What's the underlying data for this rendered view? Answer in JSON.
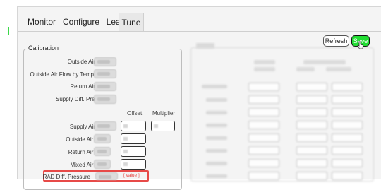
{
  "tabs": [
    {
      "label": "Monitor",
      "active": false
    },
    {
      "label": "Configure",
      "active": false
    },
    {
      "label": "Learn",
      "active": false
    },
    {
      "label": "Tune",
      "active": true
    }
  ],
  "toolbar": {
    "refresh_label": "Refresh",
    "save_label": "Save",
    "save_color": "#22dd33"
  },
  "calibration": {
    "legend": "Calibration",
    "readings": [
      {
        "label": "Outside Air Flow"
      },
      {
        "label": "Outside Air Flow by Temp"
      },
      {
        "label": "Return Air Flow"
      },
      {
        "label": "Supply Diff. Pressure"
      }
    ],
    "columns": {
      "offset": "Offset",
      "multiplier": "Multiplier"
    },
    "tunables": [
      {
        "label": "Supply Air Flow",
        "has_multiplier": true
      },
      {
        "label": "Outside Air Temp",
        "has_multiplier": false
      },
      {
        "label": "Return Air Temp",
        "has_multiplier": false
      },
      {
        "label": "Mixed Air Temp",
        "has_multiplier": false
      },
      {
        "label": "RAD Diff. Pressure",
        "has_multiplier": false,
        "highlighted": true,
        "value_placeholder": "[ value ]"
      }
    ]
  },
  "colors": {
    "highlight": "#e74a48",
    "accent_green": "#3bd84a"
  }
}
